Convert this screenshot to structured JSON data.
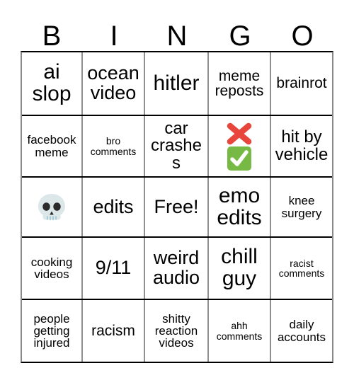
{
  "card": {
    "title": "BINGO",
    "headers": [
      "B",
      "I",
      "N",
      "G",
      "O"
    ],
    "free_space_label": "Free!",
    "colors": {
      "background": "#ffffff",
      "text": "#000000",
      "row_border": "#000000",
      "column_border": "#909090",
      "check_green": "#76b945",
      "cross_red": "#e8453c",
      "skull_bone": "#dce7ea"
    },
    "rows": [
      [
        {
          "text": "ai slop",
          "size": "fs-xl",
          "icons": []
        },
        {
          "text": "ocean video",
          "size": "fs-lg",
          "icons": []
        },
        {
          "text": "hitler",
          "size": "fs-xl",
          "icons": []
        },
        {
          "text": "meme reposts",
          "size": "fs-sm",
          "icons": []
        },
        {
          "text": "brainrot",
          "size": "fs-sm",
          "icons": []
        }
      ],
      [
        {
          "text": "facebook meme",
          "size": "fs-xs",
          "icons": []
        },
        {
          "text": "bro comments",
          "size": "fs-xxs",
          "icons": []
        },
        {
          "text": "car crashes",
          "size": "fs-md",
          "icons": []
        },
        {
          "text": "",
          "size": "fs-md",
          "icons": [
            "cross-mark-emoji",
            "check-mark-button-emoji"
          ]
        },
        {
          "text": "hit by vehicle",
          "size": "fs-md",
          "icons": []
        }
      ],
      [
        {
          "text": "",
          "size": "fs-md",
          "icons": [
            "skull-emoji"
          ]
        },
        {
          "text": "edits",
          "size": "fs-lg",
          "icons": []
        },
        {
          "text": "Free!",
          "size": "fs-lg",
          "icons": []
        },
        {
          "text": "emo edits",
          "size": "fs-xl",
          "icons": []
        },
        {
          "text": "knee surgery",
          "size": "fs-xs",
          "icons": []
        }
      ],
      [
        {
          "text": "cooking videos",
          "size": "fs-xs",
          "icons": []
        },
        {
          "text": "9/11",
          "size": "fs-lg",
          "icons": []
        },
        {
          "text": "weird audio",
          "size": "fs-lg",
          "icons": []
        },
        {
          "text": "chill guy",
          "size": "fs-xl",
          "icons": []
        },
        {
          "text": "racist comments",
          "size": "fs-xxs",
          "icons": []
        }
      ],
      [
        {
          "text": "people getting injured",
          "size": "fs-xs",
          "icons": []
        },
        {
          "text": "racism",
          "size": "fs-sm",
          "icons": []
        },
        {
          "text": "shitty reaction videos",
          "size": "fs-xs",
          "icons": []
        },
        {
          "text": "ahh comments",
          "size": "fs-xxs",
          "icons": []
        },
        {
          "text": "daily accounts",
          "size": "fs-xs",
          "icons": []
        }
      ]
    ]
  }
}
